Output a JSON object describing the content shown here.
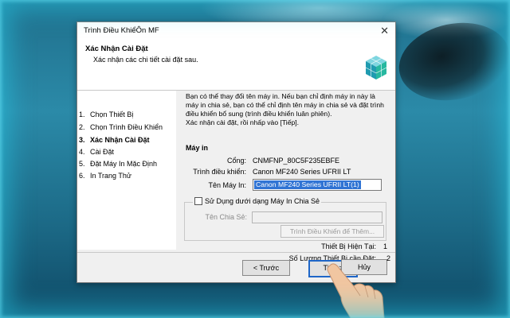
{
  "window": {
    "title": "Trình Điều KhiểÔn MF",
    "close_glyph": "✕"
  },
  "header": {
    "title": "Xác Nhận Cài Đặt",
    "subtitle": "Xác nhận các chi tiết cài đặt sau."
  },
  "steps": [
    {
      "num": "1.",
      "label": "Chọn Thiết Bị",
      "active": false
    },
    {
      "num": "2.",
      "label": "Chọn Trình Điều Khiển",
      "active": false
    },
    {
      "num": "3.",
      "label": "Xác Nhận Cài Đặt",
      "active": true
    },
    {
      "num": "4.",
      "label": "Cài Đặt",
      "active": false
    },
    {
      "num": "5.",
      "label": "Đặt Máy In Mặc Định",
      "active": false
    },
    {
      "num": "6.",
      "label": "In Trang Thử",
      "active": false
    }
  ],
  "content": {
    "description": "Bạn có thể thay đổi tên máy in. Nếu bạn chỉ định máy in này là máy in chia sẻ, bạn có thể chỉ định tên máy in chia sẻ và đặt trình điều khiển bổ sung (trình điều khiển luân phiên).",
    "description2": "Xác nhận cài đặt, rồi nhấp vào [Tiếp].",
    "section_title": "Máy in",
    "port_label": "Cổng:",
    "port_value": "CNMFNP_80C5F235EBFE",
    "driver_label": "Trình điều khiển:",
    "driver_value": "Canon MF240 Series UFRII LT",
    "printer_name_label": "Tên Máy In:",
    "printer_name_value": "Canon MF240 Series UFRII LT(1)",
    "share_checkbox_label": "Sử Dụng dưới dạng Máy In Chia Sẻ",
    "share_checked": false,
    "share_name_label": "Tên Chia Sẻ:",
    "share_name_value": "",
    "additional_driver_button": "Trình Điều Khiển để Thêm...",
    "current_devices_label": "Thiết Bị Hiện Tại:",
    "current_devices_value": "1",
    "devices_to_install_label": "Số Lượng Thiết Bị cần Đặt:",
    "devices_to_install_value": "2"
  },
  "buttons": {
    "back": "< Trước",
    "next": "Tiếp >",
    "cancel": "Hủy"
  },
  "colors": {
    "selection": "#3074d4",
    "primary_border": "#1e66c8",
    "background_water": "#1f6f8c"
  }
}
